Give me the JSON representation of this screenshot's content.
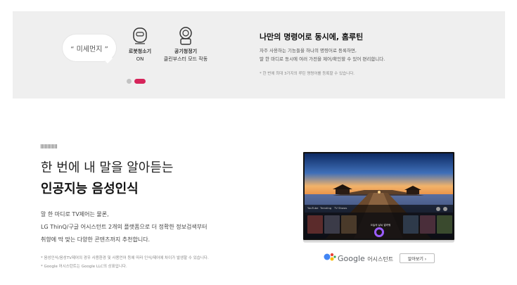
{
  "routine_panel": {
    "bubble_text": "“ 미세먼지 ”",
    "devices": [
      {
        "name": "로봇청소기",
        "state": "ON",
        "icon": "robot-cleaner-icon"
      },
      {
        "name": "공기청정기",
        "state": "클린부스터 모드 작동",
        "icon": "air-purifier-icon"
      }
    ],
    "title": "나만의 명령어로 동시에, 홈루틴",
    "desc_line1": "자주 사용하는 기능들을 하나의 명령어로 등록하면,",
    "desc_line2": "말 한 마디로 동시에 여러 가전을 제어/확인할 수 있어 편리합니다.",
    "note": "* 한 번에 최대 3가지의 루틴 명령어를 등록할 수 있습니다.",
    "carousel": {
      "active_index": 1,
      "count": 2,
      "active_color": "#d6245a",
      "inactive_color": "#c3c3c3"
    }
  },
  "voice_section": {
    "heading_line1": "한 번에 내 말을 알아듣는",
    "heading_line2": "인공지능 음성인식",
    "body_line1": "말 한 마디로 TV제어는 물론,",
    "body_line2": "LG ThinQ/구글 어시스턴트 2개의 플랫폼으로 더 정확한 정보검색부터",
    "body_line3": "취향에 딱 맞는 다양한 콘텐츠까지 추천합니다.",
    "fine_line1": "* 음성인식/음성TV제어의 경우 사용환경 및 사용언어 등에 따라 인식/제어에 차이가 발생할 수 있습니다.",
    "fine_line2": "* Google 어시스턴트는 Google LLC의 상표입니다."
  },
  "tv_screen": {
    "tabs": [
      "YouTube",
      "Trending",
      "TV Shows"
    ],
    "assistant_prompt": "오늘의 날씨 알려줘"
  },
  "google_assistant": {
    "brand": "Google",
    "label": "어시스턴트",
    "more_button": "알아보기 ›",
    "logo_colors": [
      "#4285f4",
      "#ea4335",
      "#fbbc05",
      "#34a853"
    ]
  }
}
